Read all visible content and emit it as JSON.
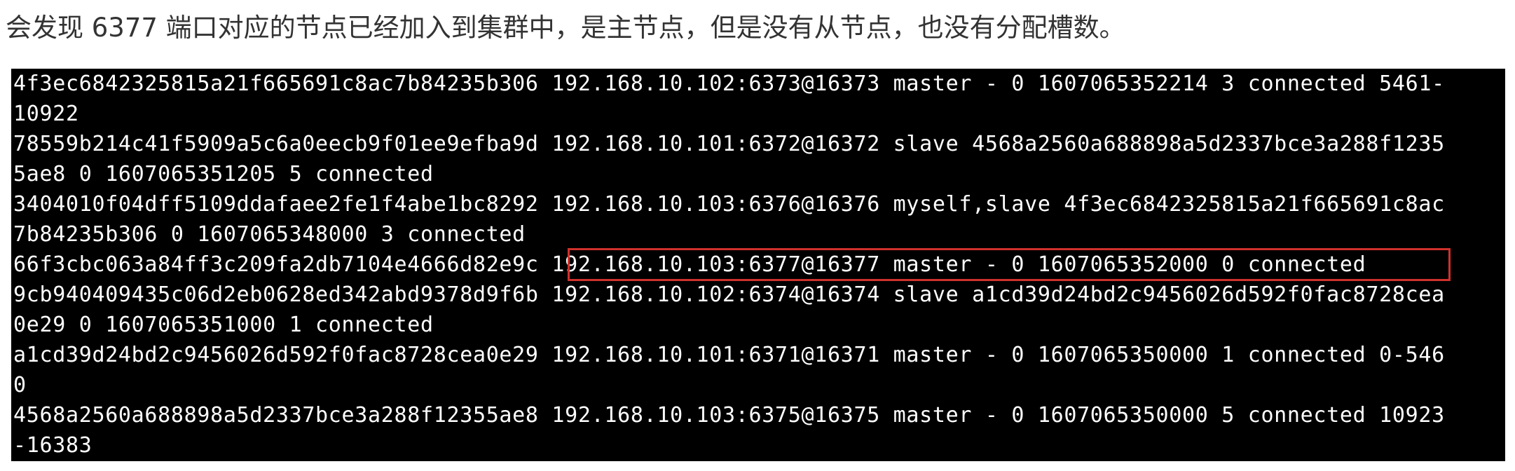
{
  "caption": "会发现 6377 端口对应的节点已经加入到集群中，是主节点，但是没有从节点，也没有分配槽数。",
  "terminal": {
    "lines": [
      "4f3ec6842325815a21f665691c8ac7b84235b306 192.168.10.102:6373@16373 master - 0 1607065352214 3 connected 5461-",
      "10922",
      "78559b214c41f5909a5c6a0eecb9f01ee9efba9d 192.168.10.101:6372@16372 slave 4568a2560a688898a5d2337bce3a288f1235",
      "5ae8 0 1607065351205 5 connected",
      "3404010f04dff5109ddafaee2fe1f4abe1bc8292 192.168.10.103:6376@16376 myself,slave 4f3ec6842325815a21f665691c8ac",
      "7b84235b306 0 1607065348000 3 connected",
      "66f3cbc063a84ff3c209fa2db7104e4666d82e9c 192.168.10.103:6377@16377 master - 0 1607065352000 0 connected",
      "9cb940409435c06d2eb0628ed342abd9378d9f6b 192.168.10.102:6374@16374 slave a1cd39d24bd2c9456026d592f0fac8728cea",
      "0e29 0 1607065351000 1 connected",
      "a1cd39d24bd2c9456026d592f0fac8728cea0e29 192.168.10.101:6371@16371 master - 0 1607065350000 1 connected 0-546",
      "0",
      "4568a2560a688898a5d2337bce3a288f12355ae8 192.168.10.103:6375@16375 master - 0 1607065350000 5 connected 10923",
      "-16383"
    ]
  },
  "colors": {
    "terminal_bg": "#000000",
    "terminal_fg": "#ffffff",
    "highlight_border": "#d0312d",
    "caption_text": "#333333"
  }
}
